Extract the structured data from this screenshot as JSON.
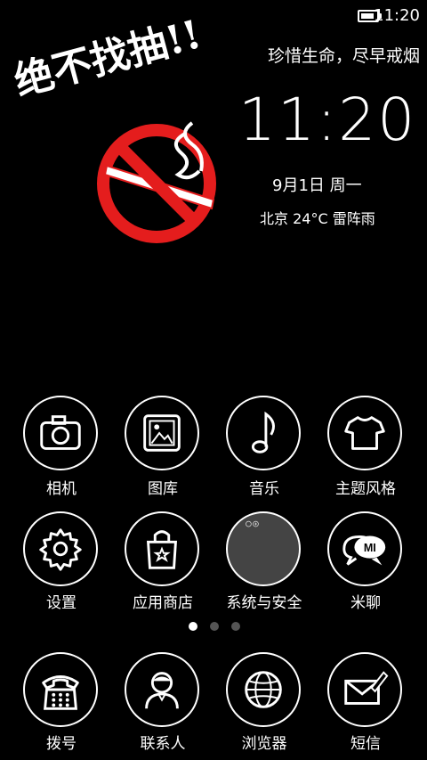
{
  "status_bar": {
    "time": "11:20",
    "battery_icon": "battery-icon",
    "battery_fraction": 0.9
  },
  "widget": {
    "slogan_top": "珍惜生命，尽早戒烟",
    "clock": "11:20",
    "date": "9月1日 周一",
    "weather": "北京  24°C  雷阵雨",
    "slogan_image": "绝不找抽!!",
    "no_smoking_icon": "no-smoking-icon"
  },
  "apps": [
    {
      "label": "相机",
      "icon": "camera-icon"
    },
    {
      "label": "图库",
      "icon": "gallery-icon"
    },
    {
      "label": "音乐",
      "icon": "music-note-icon"
    },
    {
      "label": "主题风格",
      "icon": "tshirt-icon"
    },
    {
      "label": "设置",
      "icon": "gear-icon"
    },
    {
      "label": "应用商店",
      "icon": "shopping-bag-icon"
    },
    {
      "label": "系统与安全",
      "icon": "folder-icon"
    },
    {
      "label": "米聊",
      "icon": "mi-chat-icon"
    }
  ],
  "page_indicator": {
    "count": 3,
    "active": 1
  },
  "dock": [
    {
      "label": "拨号",
      "icon": "phone-icon"
    },
    {
      "label": "联系人",
      "icon": "contacts-icon"
    },
    {
      "label": "浏览器",
      "icon": "globe-icon"
    },
    {
      "label": "短信",
      "icon": "message-icon"
    }
  ]
}
